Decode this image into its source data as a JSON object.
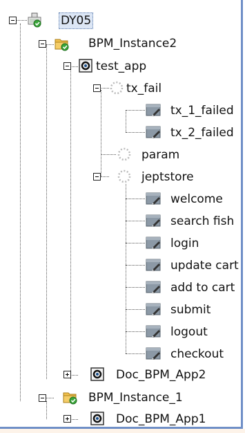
{
  "tree": {
    "root": {
      "label": "DY05",
      "selected": true,
      "icon": "host-check-icon"
    },
    "nodes": [
      {
        "label": "BPM_Instance2",
        "icon": "instance-folder-check-icon"
      },
      {
        "label": "test_app",
        "icon": "application-icon"
      },
      {
        "label": "tx_fail",
        "icon": "group-dashed-icon"
      },
      {
        "label": "tx_1_failed",
        "icon": "transaction-icon"
      },
      {
        "label": "tx_2_failed",
        "icon": "transaction-icon"
      },
      {
        "label": "param",
        "icon": "group-dashed-icon"
      },
      {
        "label": "jeptstore",
        "icon": "group-dashed-icon"
      },
      {
        "label": "welcome",
        "icon": "transaction-icon"
      },
      {
        "label": "search fish",
        "icon": "transaction-icon"
      },
      {
        "label": "login",
        "icon": "transaction-icon"
      },
      {
        "label": "update cart",
        "icon": "transaction-icon"
      },
      {
        "label": "add to cart",
        "icon": "transaction-icon"
      },
      {
        "label": "submit",
        "icon": "transaction-icon"
      },
      {
        "label": "logout",
        "icon": "transaction-icon"
      },
      {
        "label": "checkout",
        "icon": "transaction-icon"
      },
      {
        "label": "Doc_BPM_App2",
        "icon": "application-icon"
      },
      {
        "label": "BPM_Instance_1",
        "icon": "instance-folder-check-icon"
      },
      {
        "label": "Doc_BPM_App1",
        "icon": "application-icon"
      }
    ]
  },
  "colors": {
    "border": "#6f8fc7",
    "selection": "#dce6f5",
    "check": "#3aa63a",
    "folder": "#f2c14e"
  }
}
